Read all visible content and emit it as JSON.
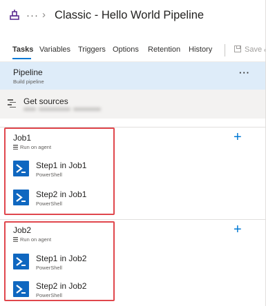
{
  "header": {
    "more_label": "···",
    "breadcrumb_separator": "›",
    "title": "Classic - Hello World Pipeline"
  },
  "tabs": [
    {
      "label": "Tasks",
      "active": true
    },
    {
      "label": "Variables",
      "active": false
    },
    {
      "label": "Triggers",
      "active": false
    },
    {
      "label": "Options",
      "active": false
    },
    {
      "label": "Retention",
      "active": false
    },
    {
      "label": "History",
      "active": false
    }
  ],
  "save": {
    "label": "Save &"
  },
  "pipeline": {
    "title": "Pipeline",
    "subtitle": "Build pipeline",
    "more_label": "···"
  },
  "get_sources": {
    "title": "Get sources"
  },
  "jobs": [
    {
      "title": "Job1",
      "subtitle": "Run on agent",
      "add_label": "+",
      "steps": [
        {
          "title": "Step1 in Job1",
          "subtitle": "PowerShell"
        },
        {
          "title": "Step2 in Job1",
          "subtitle": "PowerShell"
        }
      ]
    },
    {
      "title": "Job2",
      "subtitle": "Run on agent",
      "add_label": "+",
      "steps": [
        {
          "title": "Step1 in Job2",
          "subtitle": "PowerShell"
        },
        {
          "title": "Step2 in Job2",
          "subtitle": "PowerShell"
        }
      ]
    }
  ],
  "icons": {
    "app": "pipelines-icon",
    "save": "save-icon",
    "sources": "list-icon",
    "agent": "agent-icon",
    "task": "powershell-icon"
  },
  "colors": {
    "accent": "#0078d4",
    "selected_row": "#deecf9",
    "sources_row": "#f3f2f1",
    "powershell": "#0f67c0",
    "highlight": "#e0464c"
  }
}
